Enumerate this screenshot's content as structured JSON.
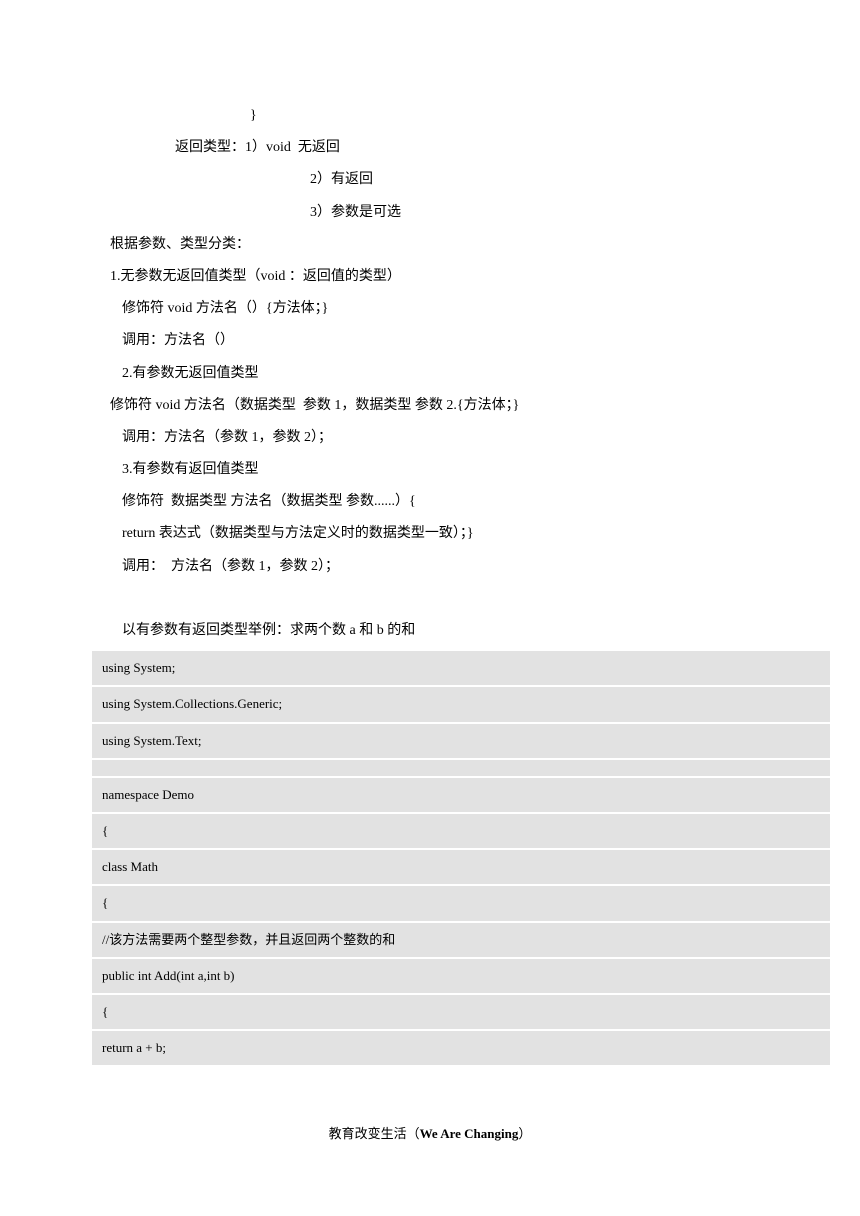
{
  "body": {
    "lines": [
      {
        "text": "}",
        "cls": "indent1"
      },
      {
        "text": "返回类型：1）void  无返回",
        "cls": "indent2"
      },
      {
        "text": "2）有返回",
        "cls": "indent3"
      },
      {
        "text": "3）参数是可选",
        "cls": "indent3"
      },
      {
        "text": "根据参数、类型分类：",
        "cls": "indent0"
      },
      {
        "text": "1.无参数无返回值类型（void ：返回值的类型）",
        "cls": "indent0"
      },
      {
        "text": "修饰符 void 方法名（）{方法体；}",
        "cls": "indent4"
      },
      {
        "text": "调用：方法名（）",
        "cls": "indent4"
      },
      {
        "text": "2.有参数无返回值类型",
        "cls": "indent4"
      },
      {
        "text": "修饰符 void 方法名（数据类型  参数 1，数据类型 参数 2.{方法体；}",
        "cls": "indent0"
      },
      {
        "text": "调用：方法名（参数 1，参数 2）；",
        "cls": "indent4"
      },
      {
        "text": "3.有参数有返回值类型",
        "cls": "indent4"
      },
      {
        "text": "修饰符  数据类型 方法名（数据类型 参数......）{",
        "cls": "indent4"
      },
      {
        "text": "return 表达式（数据类型与方法定义时的数据类型一致）；}",
        "cls": "indent4"
      },
      {
        "text": "调用：  方法名（参数 1，参数 2）；",
        "cls": "indent4"
      },
      {
        "text": " ",
        "cls": "indent0"
      },
      {
        "text": "以有参数有返回类型举例：求两个数 a 和 b 的和",
        "cls": "indent4"
      }
    ]
  },
  "code": {
    "cells": [
      "using System;",
      "using System.Collections.Generic;",
      "using System.Text;",
      " ",
      "namespace Demo",
      "{",
      "    class Math",
      "{",
      "//该方法需要两个整型参数，并且返回两个整数的和",
      "        public  int  Add(int a,int b)",
      "        {",
      "            return a + b;"
    ]
  },
  "footer": {
    "prefix": "教育改变生活（",
    "bold": "We Are Changing",
    "suffix": "）"
  }
}
